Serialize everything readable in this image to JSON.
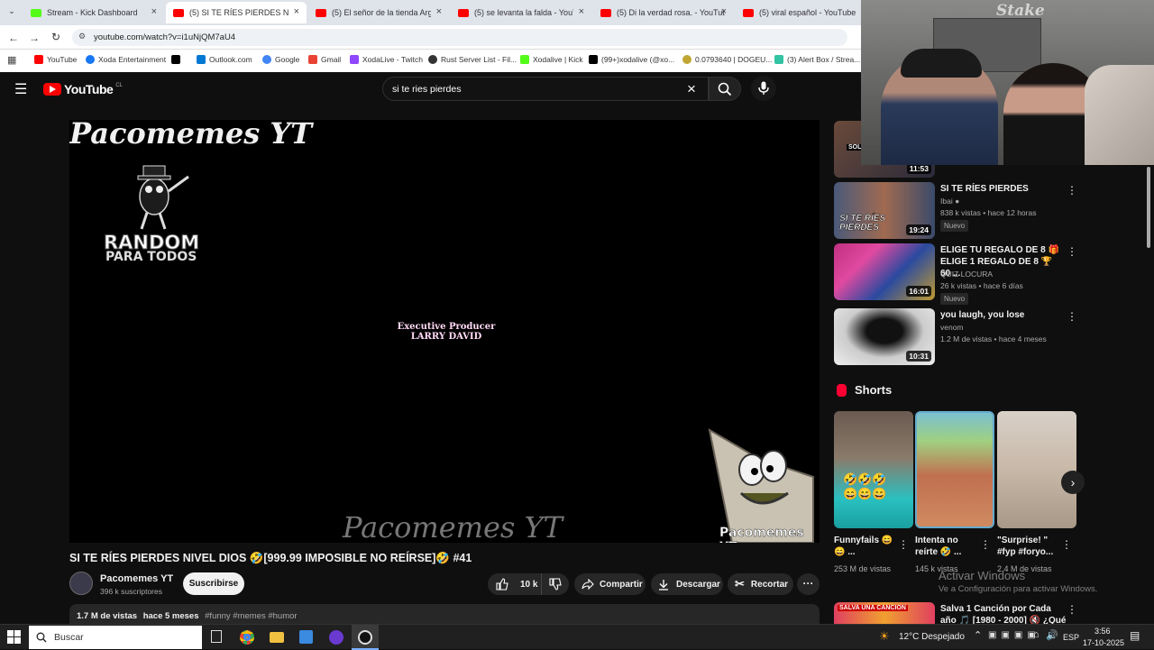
{
  "browser": {
    "tabs": [
      {
        "title": "Stream - Kick Dashboard",
        "icon": "kick-icon",
        "color": "#53fc18"
      },
      {
        "title": "(5) SI TE RÍES PIERDES NIVEL DI",
        "icon": "youtube-icon",
        "color": "#ff0000"
      },
      {
        "title": "(5) El señor de la tienda Argent",
        "icon": "youtube-icon",
        "color": "#ff0000"
      },
      {
        "title": "(5) se levanta la falda - YouTub",
        "icon": "youtube-icon",
        "color": "#ff0000"
      },
      {
        "title": "(5) Di la verdad rosa. - YouTube",
        "icon": "youtube-icon",
        "color": "#ff0000"
      },
      {
        "title": "(5) viral español - YouTube",
        "icon": "youtube-icon",
        "color": "#ff0000"
      }
    ],
    "url": "youtube.com/watch?v=i1uNjQM7aU4",
    "bookmarks": [
      {
        "label": "YouTube",
        "icon": "youtube-icon",
        "color": "#ff0000"
      },
      {
        "label": "Xoda Entertainment",
        "icon": "facebook-icon",
        "color": "#1877f2"
      },
      {
        "label": "",
        "icon": "x-icon",
        "color": "#000000"
      },
      {
        "label": "Outlook.com",
        "icon": "outlook-icon",
        "color": "#0078d4"
      },
      {
        "label": "Google",
        "icon": "google-icon",
        "color": "#4285f4"
      },
      {
        "label": "Gmail",
        "icon": "gmail-icon",
        "color": "#ea4335"
      },
      {
        "label": "XodaLive - Twitch",
        "icon": "twitch-icon",
        "color": "#9146ff"
      },
      {
        "label": "Rust Server List - Fil...",
        "icon": "rust-icon",
        "color": "#333333"
      },
      {
        "label": "Xodalive | Kick",
        "icon": "kick-icon",
        "color": "#53fc18"
      },
      {
        "label": "(99+)xodalive (@xo...",
        "icon": "tiktok-icon",
        "color": "#000000"
      },
      {
        "label": "0.0793640 | DOGEU...",
        "icon": "doge-icon",
        "color": "#c2a633"
      },
      {
        "label": "(3) Alert Box / Strea...",
        "icon": "streamlabs-icon",
        "color": "#31c3a2"
      }
    ]
  },
  "youtube": {
    "logo_text": "YouTube",
    "country_code": "CL",
    "search_value": "si te ries pierdes",
    "video": {
      "channel_watermark_top": "Pacomemes YT",
      "overlay_logo_line1": "RANDOM",
      "overlay_logo_line2": "PARA TODOS",
      "credit_line1": "Executive Producer",
      "credit_line2": "LARRY DAVID",
      "watermark_bottom": "Pacomemes YT",
      "corner_watermark": "Pacomemes YT"
    },
    "title": "SI TE RÍES PIERDES NIVEL DIOS 🤣[999.99 IMPOSIBLE NO REÍRSE]🤣 #41",
    "channel": {
      "name": "Pacomemes YT",
      "subscribers": "396 k suscriptores",
      "subscribe_label": "Suscribirse"
    },
    "actions": {
      "likes": "10 k",
      "share": "Compartir",
      "download": "Descargar",
      "clip": "Recortar"
    },
    "description_meta": {
      "views": "1.7 M de vistas",
      "age": "hace 5 meses",
      "tags": "#funny #memes #humor"
    },
    "sidebar": [
      {
        "title": "",
        "channel": "",
        "meta": "",
        "duration": "11:53",
        "badge": "",
        "thumb_text": "SOL"
      },
      {
        "title": "SI TE RÍES PIERDES",
        "channel": "Ibai",
        "meta": "838 k vistas • hace 12 horas",
        "duration": "19:24",
        "badge": "Nuevo",
        "thumb_text": "SI TE RÍES PIERDES"
      },
      {
        "title": "ELIGE TU REGALO DE 8 🎁 ELIGE 1 REGALO DE 8 🏆 60 ...",
        "channel": "QUIZ LOCURA",
        "meta": "26 k vistas • hace 6 días",
        "duration": "16:01",
        "badge": "Nuevo",
        "thumb_text": ""
      },
      {
        "title": "you laugh, you lose",
        "channel": "venom",
        "meta": "1.2 M de vistas • hace 4 meses",
        "duration": "10:31",
        "badge": "",
        "thumb_text": ""
      }
    ],
    "shorts_heading": "Shorts",
    "shorts": [
      {
        "title": "Funnyfails 😄😄 ...",
        "views": "253 M de vistas"
      },
      {
        "title": "Intenta no reírte 🤣 ...",
        "views": "145 k vistas"
      },
      {
        "title": "\"Surprise! \" #fyp #foryo...",
        "views": "2.4 M de vistas"
      }
    ],
    "next_item": {
      "title": "Salva 1 Canción por Cada año 🎵 [1980 - 2000] 🔇 ¿Qué ...",
      "thumb_text": "SALVA UNA CANCION"
    }
  },
  "webcam": {
    "brand": "Stake"
  },
  "windows_watermark": {
    "line1": "Activar Windows",
    "line2": "Ve a Configuración para activar Windows."
  },
  "taskbar": {
    "search_placeholder": "Buscar",
    "weather": "12°C Despejado",
    "language": "ESP",
    "time": "3:56",
    "date": "17-10-2025"
  }
}
